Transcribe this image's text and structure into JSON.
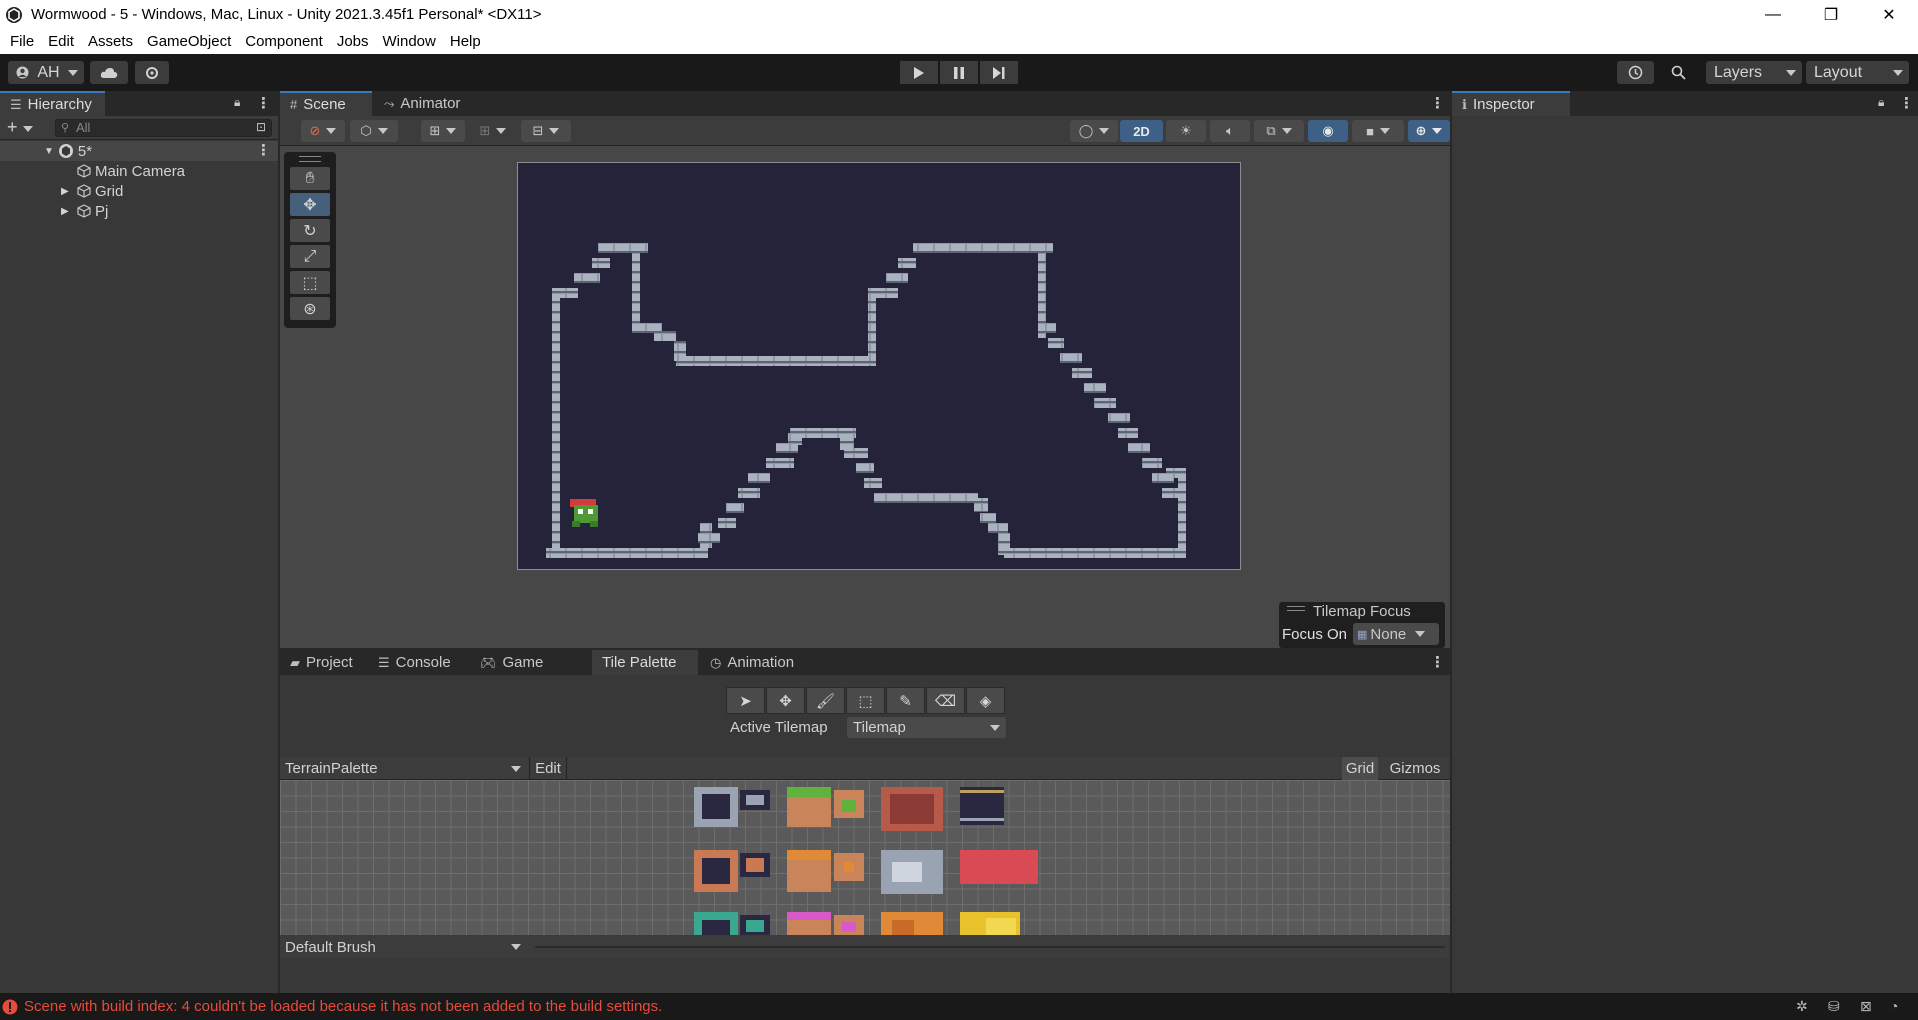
{
  "window": {
    "title": "Wormwood - 5 - Windows, Mac, Linux - Unity 2021.3.45f1 Personal* <DX11>",
    "minimize": "—",
    "maximize": "❐",
    "close": "✕"
  },
  "menu": [
    "File",
    "Edit",
    "Assets",
    "GameObject",
    "Component",
    "Jobs",
    "Window",
    "Help"
  ],
  "toolbar": {
    "account": "AH",
    "layers": "Layers",
    "layout": "Layout"
  },
  "hierarchy": {
    "tab": "Hierarchy",
    "search_placeholder": "All",
    "scene": "5*",
    "items": [
      "Main Camera",
      "Grid",
      "Pj"
    ]
  },
  "scene": {
    "tab_scene": "Scene",
    "tab_animator": "Animator",
    "mode_2d": "2D",
    "tilemap_focus_title": "Tilemap Focus",
    "focus_on_label": "Focus On",
    "focus_on_value": "None"
  },
  "inspector": {
    "tab": "Inspector"
  },
  "bottom": {
    "tabs": [
      "Project",
      "Console",
      "Game",
      "Tile Palette",
      "Animation"
    ],
    "active_tilemap_label": "Active Tilemap",
    "active_tilemap_value": "Tilemap",
    "palette": "TerrainPalette",
    "edit": "Edit",
    "grid": "Grid",
    "gizmos": "Gizmos",
    "brush": "Default Brush"
  },
  "status": {
    "message": "Scene with build index: 4 couldn't be loaded because it has not been added to the build settings."
  },
  "colors": {
    "accent": "#3a79bb",
    "error": "#e74b3c",
    "game_bg": "#25233a"
  }
}
